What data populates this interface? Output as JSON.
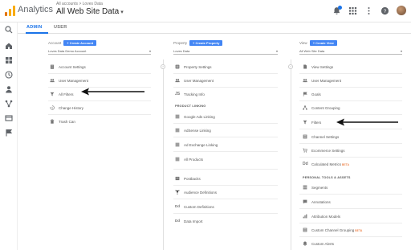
{
  "app": {
    "brand": "Analytics",
    "crumbs": "All accounts > Loves Data",
    "account_title": "All Web Site Data"
  },
  "colors": {
    "accent": "#1a73e8",
    "button": "#4285f4",
    "beta": "#e65100"
  },
  "tabs": [
    {
      "label": "ADMIN",
      "active": true
    },
    {
      "label": "USER",
      "active": false
    }
  ],
  "account": {
    "heading": "Account",
    "create_label": "+ Create Account",
    "selected": "Loves Data Demo Account",
    "items": [
      {
        "label": "Account Settings",
        "icon": "building-icon"
      },
      {
        "label": "User Management",
        "icon": "users-icon"
      },
      {
        "label": "All Filters",
        "icon": "filter-icon"
      },
      {
        "label": "Change History",
        "icon": "history-icon"
      },
      {
        "label": "Trash Can",
        "icon": "trash-icon"
      }
    ]
  },
  "property": {
    "heading": "Property",
    "create_label": "+ Create Property",
    "selected": "Loves Data",
    "items": [
      {
        "label": "Property Settings",
        "icon": "settings-icon"
      },
      {
        "label": "User Management",
        "icon": "users-icon"
      },
      {
        "label": "Tracking Info",
        "icon": "code-icon"
      }
    ],
    "section": "PRODUCT LINKING",
    "linking": [
      {
        "label": "Google Ads Linking",
        "icon": "ads-icon"
      },
      {
        "label": "AdSense Linking",
        "icon": "adsense-icon"
      },
      {
        "label": "Ad Exchange Linking",
        "icon": "adx-icon"
      },
      {
        "label": "All Products",
        "icon": "products-icon"
      }
    ],
    "more": [
      {
        "label": "Postbacks",
        "icon": "postbacks-icon"
      },
      {
        "label": "Audience Definitions",
        "icon": "audience-icon"
      },
      {
        "label": "Custom Definitions",
        "icon": "dd-icon"
      },
      {
        "label": "Data Import",
        "icon": "dd-icon"
      }
    ]
  },
  "view": {
    "heading": "View",
    "create_label": "+ Create View",
    "selected": "All Web Site Data",
    "items": [
      {
        "label": "View Settings",
        "icon": "document-icon"
      },
      {
        "label": "User Management",
        "icon": "users-icon"
      },
      {
        "label": "Goals",
        "icon": "flag-icon"
      },
      {
        "label": "Content Grouping",
        "icon": "grouping-icon"
      },
      {
        "label": "Filters",
        "icon": "filter-icon"
      },
      {
        "label": "Channel Settings",
        "icon": "channel-icon"
      },
      {
        "label": "Ecommerce Settings",
        "icon": "cart-icon"
      },
      {
        "label": "Calculated Metrics",
        "icon": "calc-icon",
        "badge": "BETA"
      }
    ],
    "section": "PERSONAL TOOLS & ASSETS",
    "tools": [
      {
        "label": "Segments",
        "icon": "segments-icon"
      },
      {
        "label": "Annotations",
        "icon": "annotations-icon"
      },
      {
        "label": "Attribution Models",
        "icon": "attribution-icon"
      },
      {
        "label": "Custom Channel Grouping",
        "icon": "channel-icon",
        "badge": "BETA"
      },
      {
        "label": "Custom Alerts",
        "icon": "alert-icon"
      }
    ]
  }
}
